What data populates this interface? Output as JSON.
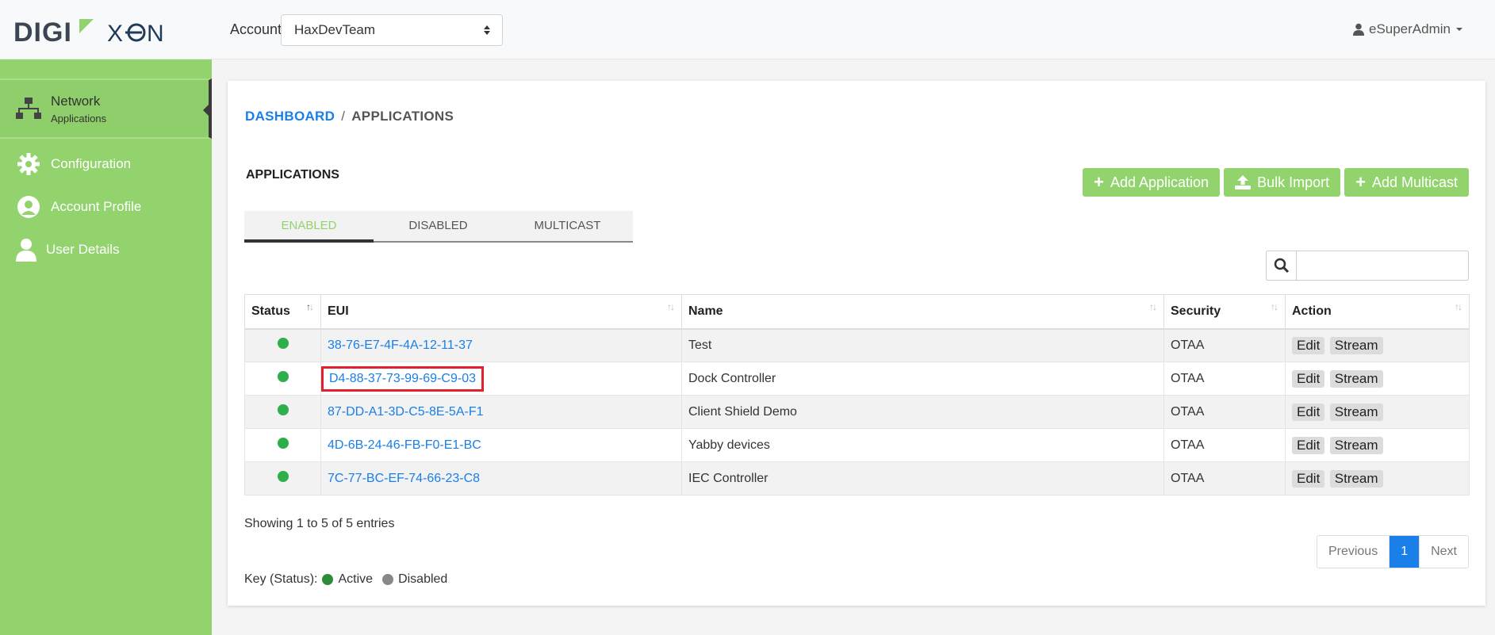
{
  "header": {
    "logo_left": "DIGI",
    "logo_right": "X⊖N",
    "account_label": "Account",
    "account_value": "HaxDevTeam",
    "user": "eSuperAdmin"
  },
  "sidebar": {
    "items": [
      {
        "label": "Network",
        "sub": "Applications",
        "icon": "network-icon"
      },
      {
        "label": "Configuration",
        "icon": "gear-icon"
      },
      {
        "label": "Account Profile",
        "icon": "account-circle-icon"
      },
      {
        "label": "User Details",
        "icon": "user-icon"
      }
    ]
  },
  "breadcrumb": {
    "home": "DASHBOARD",
    "sep": "/",
    "current": "APPLICATIONS"
  },
  "section_title": "APPLICATIONS",
  "actions": {
    "add_app": "Add Application",
    "bulk_import": "Bulk Import",
    "add_multicast": "Add Multicast"
  },
  "tabs": [
    "ENABLED",
    "DISABLED",
    "MULTICAST"
  ],
  "table": {
    "headers": [
      "Status",
      "EUI",
      "Name",
      "Security",
      "Action"
    ],
    "rows": [
      {
        "eui": "38-76-E7-4F-4A-12-11-37",
        "name": "Test",
        "security": "OTAA"
      },
      {
        "eui": "D4-88-37-73-99-69-C9-03",
        "name": "Dock Controller",
        "security": "OTAA"
      },
      {
        "eui": "87-DD-A1-3D-C5-8E-5A-F1",
        "name": "Client Shield Demo",
        "security": "OTAA"
      },
      {
        "eui": "4D-6B-24-46-FB-F0-E1-BC",
        "name": "Yabby devices",
        "security": "OTAA"
      },
      {
        "eui": "7C-77-BC-EF-74-66-23-C8",
        "name": "IEC Controller",
        "security": "OTAA"
      }
    ],
    "edit_label": "Edit",
    "stream_label": "Stream"
  },
  "footer": {
    "showing": "Showing 1 to 5 of 5 entries",
    "prev": "Previous",
    "page": "1",
    "next": "Next",
    "key_label": "Key (Status):",
    "key_active": "Active",
    "key_disabled": "Disabled"
  },
  "colors": {
    "accent_green": "#92d36e",
    "link_blue": "#1a7fe8",
    "status_active": "#2eaf4a",
    "status_disabled": "#888888",
    "highlight_red": "#e4202a"
  }
}
